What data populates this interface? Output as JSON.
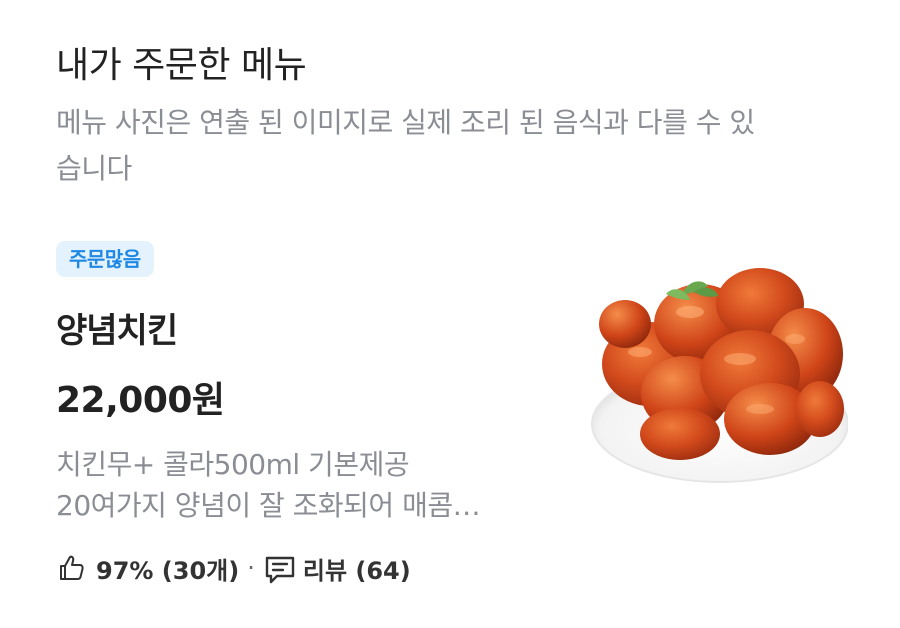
{
  "section": {
    "title": "내가 주문한 메뉴",
    "notice": "메뉴 사진은 연출 된 이미지로 실제 조리 된 음식과 다를 수 있습니다"
  },
  "menu": {
    "badge": "주문많음",
    "name": "양념치킨",
    "price": "22,000원",
    "description_lines": [
      "치킨무+ 콜라500ml 기본제공",
      "20여가지 양념이 잘 조화되어 매콤…"
    ],
    "image_icon": "fried-chicken-photo"
  },
  "stats": {
    "like_icon": "thumbs-up-icon",
    "like_text": "97% (30개)",
    "separator": "·",
    "review_icon": "review-bubble-icon",
    "review_text": "리뷰 (64)"
  },
  "colors": {
    "badge_bg": "#e3f2fd",
    "badge_text": "#1e88e5",
    "muted_text": "#8a8e94"
  }
}
